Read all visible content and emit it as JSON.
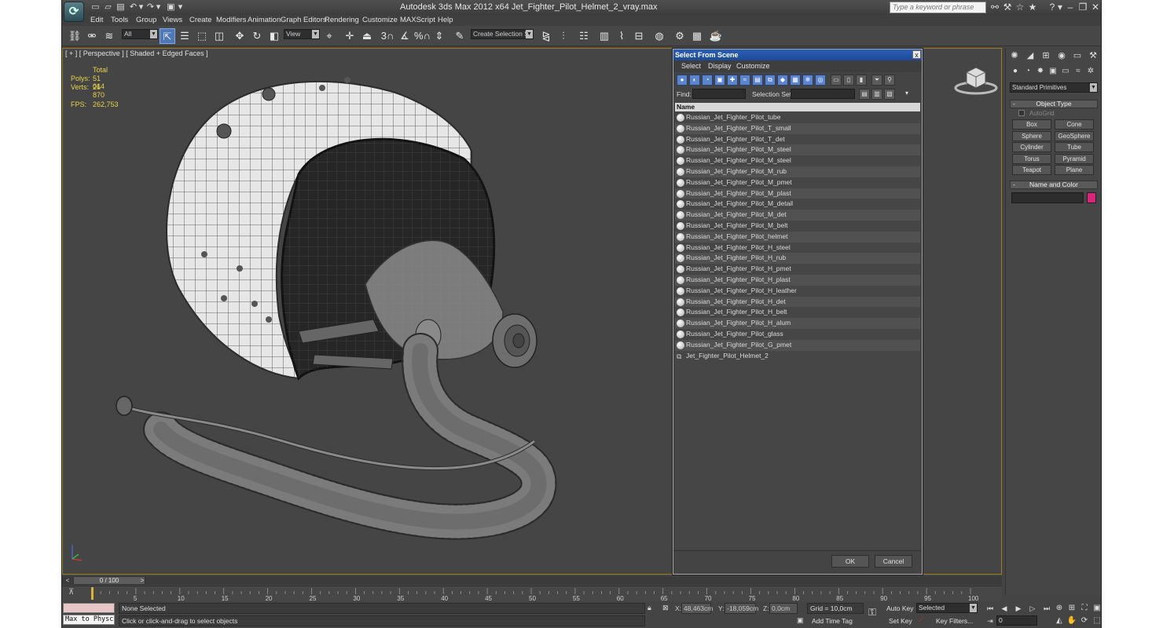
{
  "app": {
    "logo": "3ds-max-logo",
    "title": "Autodesk 3ds Max  2012 x64      Jet_Fighter_Pilot_Helmet_2_vray.max",
    "search_placeholder": "Type a keyword or phrase"
  },
  "menu": [
    "Edit",
    "Tools",
    "Group",
    "Views",
    "Create",
    "Modifiers",
    "Animation",
    "Graph Editors",
    "Rendering",
    "Customize",
    "MAXScript",
    "Help"
  ],
  "toolbar": {
    "selection_filter": "All",
    "ref_coord": "View",
    "named_selection_placeholder": "Create Selection Se",
    "snap_labels": [
      "3",
      "%"
    ]
  },
  "viewport": {
    "label": "[ + ] [ Perspective ] [ Shaded + Edged Faces ]",
    "stats": {
      "header": "Total",
      "polys_label": "Polys:",
      "polys": "51 014",
      "verts_label": "Verts:",
      "verts": "26 870",
      "fps_label": "FPS:",
      "fps": "262,753"
    }
  },
  "dialog": {
    "title": "Select From Scene",
    "close": "x",
    "menu": [
      "Select",
      "Display",
      "Customize"
    ],
    "find_label": "Find:",
    "find_value": "",
    "selection_set_label": "Selection Set:",
    "selection_set_value": "",
    "column_header": "Name",
    "items": [
      "Russian_Jet_Fighter_Pilot_tube",
      "Russian_Jet_Fighter_Pilot_T_small",
      "Russian_Jet_Fighter_Pilot_T_det",
      "Russian_Jet_Fighter_Pilot_M_steel",
      "Russian_Jet_Fighter_Pilot_M_steel",
      "Russian_Jet_Fighter_Pilot_M_rub",
      "Russian_Jet_Fighter_Pilot_M_pmet",
      "Russian_Jet_Fighter_Pilot_M_plast",
      "Russian_Jet_Fighter_Pilot_M_detail",
      "Russian_Jet_Fighter_Pilot_M_det",
      "Russian_Jet_Fighter_Pilot_M_belt",
      "Russian_Jet_Fighter_Pilot_helmet",
      "Russian_Jet_Fighter_Pilot_H_steel",
      "Russian_Jet_Fighter_Pilot_H_rub",
      "Russian_Jet_Fighter_Pilot_H_pmet",
      "Russian_Jet_Fighter_Pilot_H_plast",
      "Russian_Jet_Fighter_Pilot_H_leather",
      "Russian_Jet_Fighter_Pilot_H_det",
      "Russian_Jet_Fighter_Pilot_H_belt",
      "Russian_Jet_Fighter_Pilot_H_alum",
      "Russian_Jet_Fighter_Pilot_glass",
      "Russian_Jet_Fighter_Pilot_G_pmet"
    ],
    "group_item": "Jet_Fighter_Pilot_Helmet_2",
    "ok": "OK",
    "cancel": "Cancel"
  },
  "command_panel": {
    "category": "Standard Primitives",
    "object_type_title": "Object Type",
    "autogrid": "AutoGrid",
    "primitives": [
      "Box",
      "Cone",
      "Sphere",
      "GeoSphere",
      "Cylinder",
      "Tube",
      "Torus",
      "Pyramid",
      "Teapot",
      "Plane"
    ],
    "name_color_title": "Name and Color",
    "object_color": "#d8247d"
  },
  "time": {
    "slider": "0 / 100",
    "tick_labels": [
      "5",
      "10",
      "15",
      "20",
      "25",
      "30",
      "35",
      "40",
      "45",
      "50",
      "55",
      "60",
      "65",
      "70",
      "75",
      "80",
      "85",
      "90",
      "95",
      "100"
    ]
  },
  "status": {
    "maxscript": "Max to Physc",
    "selection": "None Selected",
    "prompt": "Click or click-and-drag to select objects",
    "x_label": "X:",
    "x": "48,463cm",
    "y_label": "Y:",
    "y": "-18,059cm",
    "z_label": "Z:",
    "z": "0,0cm",
    "grid": "Grid = 10,0cm",
    "add_time_tag": "Add Time Tag",
    "auto_key": "Auto Key",
    "set_key": "Set Key",
    "key_mode": "Selected",
    "key_filters": "Key Filters...",
    "current_frame": "0"
  },
  "colors": {
    "viewport_border": "#a37a1e",
    "stats_text": "#e7d34b",
    "dialog_title": "#2a5fb5"
  }
}
